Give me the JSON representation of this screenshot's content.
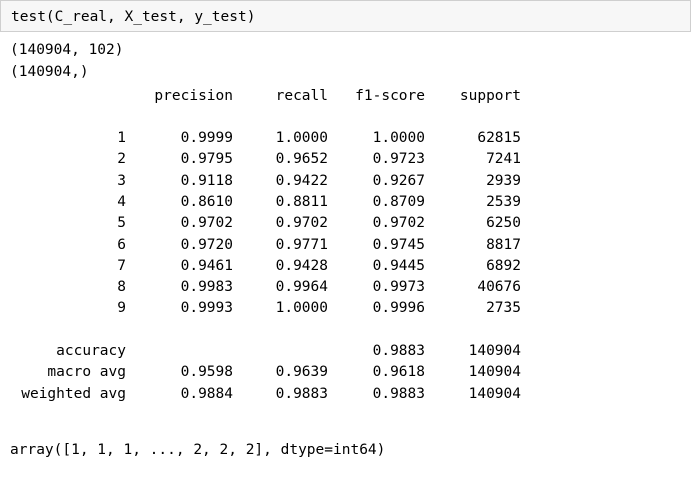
{
  "input": {
    "code": "test(C_real, X_test, y_test)"
  },
  "output": {
    "shape_x": "(140904, 102)",
    "shape_y": "(140904,)",
    "headers": [
      "precision",
      "recall",
      "f1-score",
      "support"
    ],
    "rows": [
      {
        "label": "1",
        "precision": "0.9999",
        "recall": "1.0000",
        "f1": "1.0000",
        "support": "62815"
      },
      {
        "label": "2",
        "precision": "0.9795",
        "recall": "0.9652",
        "f1": "0.9723",
        "support": "7241"
      },
      {
        "label": "3",
        "precision": "0.9118",
        "recall": "0.9422",
        "f1": "0.9267",
        "support": "2939"
      },
      {
        "label": "4",
        "precision": "0.8610",
        "recall": "0.8811",
        "f1": "0.8709",
        "support": "2539"
      },
      {
        "label": "5",
        "precision": "0.9702",
        "recall": "0.9702",
        "f1": "0.9702",
        "support": "6250"
      },
      {
        "label": "6",
        "precision": "0.9720",
        "recall": "0.9771",
        "f1": "0.9745",
        "support": "8817"
      },
      {
        "label": "7",
        "precision": "0.9461",
        "recall": "0.9428",
        "f1": "0.9445",
        "support": "6892"
      },
      {
        "label": "8",
        "precision": "0.9983",
        "recall": "0.9964",
        "f1": "0.9973",
        "support": "40676"
      },
      {
        "label": "9",
        "precision": "0.9993",
        "recall": "1.0000",
        "f1": "0.9996",
        "support": "2735"
      }
    ],
    "summary": [
      {
        "label": "accuracy",
        "precision": "",
        "recall": "",
        "f1": "0.9883",
        "support": "140904"
      },
      {
        "label": "macro avg",
        "precision": "0.9598",
        "recall": "0.9639",
        "f1": "0.9618",
        "support": "140904"
      },
      {
        "label": "weighted avg",
        "precision": "0.9884",
        "recall": "0.9883",
        "f1": "0.9883",
        "support": "140904"
      }
    ],
    "array_repr": "array([1, 1, 1, ..., 2, 2, 2], dtype=int64)"
  }
}
